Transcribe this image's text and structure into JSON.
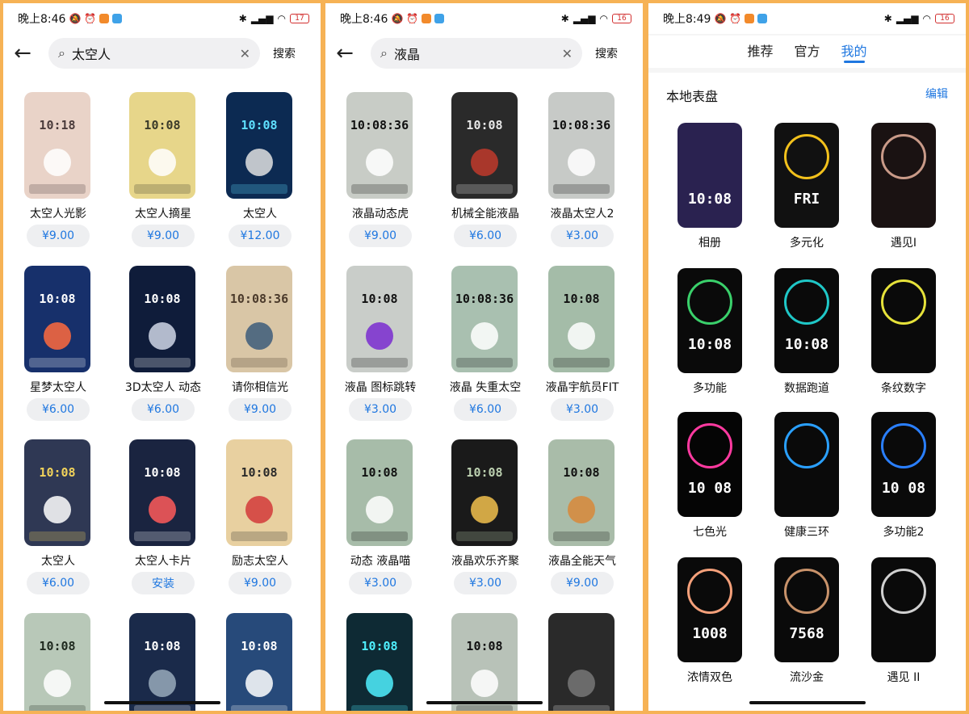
{
  "colors": {
    "accent": "#1f77e0",
    "frame": "#f6b255",
    "battery": "#d23030"
  },
  "panel1": {
    "status": {
      "time": "晚上8:46",
      "battery": "17"
    },
    "search": {
      "query": "太空人",
      "button": "搜索"
    },
    "items": [
      {
        "name": "太空人光影",
        "price": "¥9.00",
        "face_time": "10:18",
        "bg": "#e9d3c8",
        "fg": "#4a3b3b",
        "deco": "#ffffff"
      },
      {
        "name": "太空人摘星",
        "price": "¥9.00",
        "face_time": "10:08",
        "bg": "#e7d68a",
        "fg": "#3b3b2a",
        "deco": "#ffffff"
      },
      {
        "name": "太空人",
        "price": "¥12.00",
        "face_time": "10:08",
        "bg": "#0c2a52",
        "fg": "#5fe0ff",
        "deco": "#e0e0e0"
      },
      {
        "name": "星梦太空人",
        "price": "¥6.00",
        "face_time": "10:08",
        "bg": "#17306b",
        "fg": "#ffffff",
        "deco": "#ff6a3d"
      },
      {
        "name": "3D太空人 动态",
        "price": "¥6.00",
        "face_time": "10:08",
        "bg": "#0f1c3a",
        "fg": "#ffffff",
        "deco": "#cfd6e6"
      },
      {
        "name": "请你相信光",
        "price": "¥9.00",
        "face_time": "10:08:36",
        "bg": "#d9c6a6",
        "fg": "#4b3a2b",
        "deco": "#3c5c7a"
      },
      {
        "name": "太空人",
        "price": "¥6.00",
        "face_time": "10:08",
        "bg": "#2f3854",
        "fg": "#f2d35b",
        "deco": "#ffffff"
      },
      {
        "name": "太空人卡片",
        "price": "安装",
        "face_time": "10:08",
        "bg": "#1a2440",
        "fg": "#ffffff",
        "deco": "#ff5a5a"
      },
      {
        "name": "励志太空人",
        "price": "¥9.00",
        "face_time": "10:08",
        "bg": "#e8d0a0",
        "fg": "#2a2a2a",
        "deco": "#d23a3a"
      },
      {
        "name": "",
        "price": "",
        "face_time": "10:08",
        "bg": "#b8c8b8",
        "fg": "#1f2a1f",
        "deco": "#ffffff"
      },
      {
        "name": "",
        "price": "",
        "face_time": "10:08",
        "bg": "#1a2a4a",
        "fg": "#ffffff",
        "deco": "#9ab"
      },
      {
        "name": "",
        "price": "",
        "face_time": "10:08",
        "bg": "#274a7a",
        "fg": "#ffffff",
        "deco": "#ffffff"
      }
    ]
  },
  "panel2": {
    "status": {
      "time": "晚上8:46",
      "battery": "16"
    },
    "search": {
      "query": "液晶",
      "button": "搜索"
    },
    "items": [
      {
        "name": "液晶动态虎",
        "price": "¥9.00",
        "face_time": "10:08:36",
        "bg": "#c8ccc6",
        "fg": "#111111",
        "deco": "#ffffff"
      },
      {
        "name": "机械全能液晶",
        "price": "¥6.00",
        "face_time": "10:08",
        "bg": "#2a2a2a",
        "fg": "#e8e8e8",
        "deco": "#c0392b"
      },
      {
        "name": "液晶太空人2",
        "price": "¥3.00",
        "face_time": "10:08:36",
        "bg": "#c7cac7",
        "fg": "#111111",
        "deco": "#ffffff"
      },
      {
        "name": "液晶 图标跳转",
        "price": "¥3.00",
        "face_time": "10:08",
        "bg": "#c9cdc9",
        "fg": "#111111",
        "deco": "#7a2bd0"
      },
      {
        "name": "液晶 失重太空",
        "price": "¥6.00",
        "face_time": "10:08:36",
        "bg": "#a9c0b0",
        "fg": "#111111",
        "deco": "#ffffff"
      },
      {
        "name": "液晶宇航员FIT",
        "price": "¥3.00",
        "face_time": "10:08",
        "bg": "#a4bca8",
        "fg": "#111111",
        "deco": "#ffffff"
      },
      {
        "name": "动态 液晶喵",
        "price": "¥3.00",
        "face_time": "10:08",
        "bg": "#a7bca9",
        "fg": "#111111",
        "deco": "#ffffff"
      },
      {
        "name": "液晶欢乐齐聚",
        "price": "¥3.00",
        "face_time": "10:08",
        "bg": "#1a1a1a",
        "fg": "#bcd0b0",
        "deco": "#f2c14e"
      },
      {
        "name": "液晶全能天气",
        "price": "¥9.00",
        "face_time": "10:08",
        "bg": "#a9bca9",
        "fg": "#111111",
        "deco": "#d8883a"
      },
      {
        "name": "",
        "price": "",
        "face_time": "10:08",
        "bg": "#0e2a34",
        "fg": "#4ff0ff",
        "deco": "#4ff0ff"
      },
      {
        "name": "",
        "price": "",
        "face_time": "10:08",
        "bg": "#b8c2b8",
        "fg": "#111111",
        "deco": "#ffffff"
      },
      {
        "name": "",
        "price": "",
        "face_time": "",
        "bg": "#2a2a2a",
        "fg": "#e0e0e0",
        "deco": "#777777"
      }
    ]
  },
  "panel3": {
    "status": {
      "time": "晚上8:49",
      "battery": "16"
    },
    "tabs": [
      "推荐",
      "官方",
      "我的"
    ],
    "section_title": "本地表盘",
    "edit_label": "编辑",
    "items": [
      {
        "name": "相册",
        "face_time": "10:08",
        "bg": "#2a2250",
        "ring": "#00000000"
      },
      {
        "name": "多元化",
        "face_time": "FRI",
        "bg": "#111111",
        "ring": "#f2c11c"
      },
      {
        "name": "遇见I",
        "face_time": "",
        "bg": "#1a1212",
        "ring": "#c99a88"
      },
      {
        "name": "多功能",
        "face_time": "10:08",
        "bg": "#0a0a0a",
        "ring": "#3ad06b"
      },
      {
        "name": "数据跑道",
        "face_time": "10:08",
        "bg": "#0a0a0a",
        "ring": "#1fc7c7"
      },
      {
        "name": "条纹数字",
        "face_time": "",
        "bg": "#0a0a0a",
        "ring": "#e6e23a"
      },
      {
        "name": "七色光",
        "face_time": "10 08",
        "bg": "#050505",
        "ring": "#ff3aa0"
      },
      {
        "name": "健康三环",
        "face_time": "",
        "bg": "#0a0a0a",
        "ring": "#2aa0ff"
      },
      {
        "name": "多功能2",
        "face_time": "10 08",
        "bg": "#0a0a0a",
        "ring": "#2a7fff"
      },
      {
        "name": "浓情双色",
        "face_time": "1008",
        "bg": "#0a0a0a",
        "ring": "#f4a07a"
      },
      {
        "name": "流沙金",
        "face_time": "7568",
        "bg": "#0a0a0a",
        "ring": "#c8926a"
      },
      {
        "name": "遇见 II",
        "face_time": "",
        "bg": "#0a0a0a",
        "ring": "#d0d0d0"
      }
    ]
  }
}
